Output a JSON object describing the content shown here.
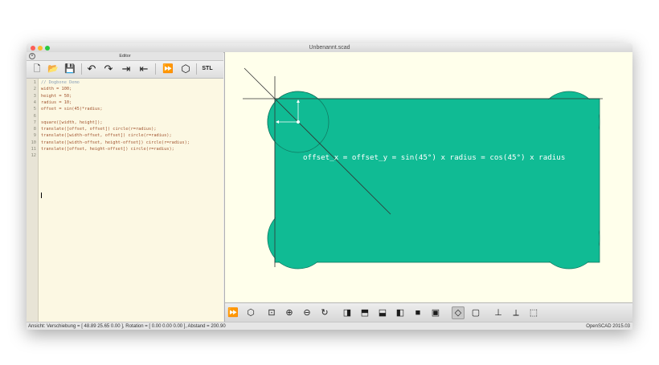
{
  "window": {
    "title": "Unbenannt.scad"
  },
  "editor": {
    "title": "Editor",
    "lines": [
      {
        "num": "1",
        "text": "// Dogbone Demo",
        "kind": "comment"
      },
      {
        "num": "2",
        "text": "width = 100;",
        "kind": "code"
      },
      {
        "num": "3",
        "text": "height = 50;",
        "kind": "code"
      },
      {
        "num": "4",
        "text": "radius = 10;",
        "kind": "code"
      },
      {
        "num": "5",
        "text": "offset = sin(45)*radius;",
        "kind": "code"
      },
      {
        "num": "6",
        "text": "",
        "kind": "code"
      },
      {
        "num": "7",
        "text": "square([width, height]);",
        "kind": "code"
      },
      {
        "num": "8",
        "text": "translate([offset, offset]) circle(r=radius);",
        "kind": "code"
      },
      {
        "num": "9",
        "text": "translate([width-offset, offset]) circle(r=radius);",
        "kind": "code"
      },
      {
        "num": "10",
        "text": "translate([width-offset, height-offset]) circle(r=radius);",
        "kind": "code"
      },
      {
        "num": "11",
        "text": "translate([offset, height-offset]) circle(r=radius);",
        "kind": "code"
      },
      {
        "num": "12",
        "text": "",
        "kind": "code"
      }
    ],
    "toolbar": [
      {
        "name": "new-file-icon",
        "glyph": "🗋"
      },
      {
        "name": "open-folder-icon",
        "glyph": "📂"
      },
      {
        "name": "save-icon",
        "glyph": "💾"
      },
      {
        "name": "undo-icon",
        "glyph": "↶"
      },
      {
        "name": "redo-icon",
        "glyph": "↷"
      },
      {
        "name": "indent-icon",
        "glyph": "⇥"
      },
      {
        "name": "unindent-icon",
        "glyph": "⇤"
      },
      {
        "name": "preview-icon",
        "glyph": "⏩"
      },
      {
        "name": "render-icon",
        "glyph": "⬡"
      },
      {
        "name": "export-stl-icon",
        "glyph": "STL"
      }
    ]
  },
  "viewport": {
    "annotation": "offset_x = offset_y = sin(45°) x radius = cos(45°) x radius",
    "shape_color": "#10bb94",
    "background": "#ffffeb"
  },
  "view_toolbar": [
    {
      "name": "preview-icon",
      "glyph": "⏩",
      "active": false
    },
    {
      "name": "render-icon",
      "glyph": "⬡",
      "active": false
    },
    {
      "name": "view-all-icon",
      "glyph": "⊡",
      "active": false
    },
    {
      "name": "zoom-in-icon",
      "glyph": "⊕",
      "active": false
    },
    {
      "name": "zoom-out-icon",
      "glyph": "⊖",
      "active": false
    },
    {
      "name": "reset-view-icon",
      "glyph": "↻",
      "active": false
    },
    {
      "name": "view-right-icon",
      "glyph": "◨",
      "active": false
    },
    {
      "name": "view-top-icon",
      "glyph": "⬒",
      "active": false
    },
    {
      "name": "view-bottom-icon",
      "glyph": "⬓",
      "active": false
    },
    {
      "name": "view-left-icon",
      "glyph": "◧",
      "active": false
    },
    {
      "name": "view-front-icon",
      "glyph": "■",
      "active": false
    },
    {
      "name": "view-back-icon",
      "glyph": "▣",
      "active": false
    },
    {
      "name": "perspective-icon",
      "glyph": "◇",
      "active": true
    },
    {
      "name": "orthogonal-icon",
      "glyph": "▢",
      "active": false
    },
    {
      "name": "show-axes-icon",
      "glyph": "⊥",
      "active": false
    },
    {
      "name": "show-scale-icon",
      "glyph": "⟂",
      "active": false
    },
    {
      "name": "show-edges-icon",
      "glyph": "⬚",
      "active": false
    }
  ],
  "status": {
    "left": "Ansicht: Verschiebung = [ 48.89 25.65 0.00 ], Rotation = [ 0.00 0.00 0.00 ], Abstand = 200.90",
    "right": "OpenSCAD 2015.03"
  }
}
